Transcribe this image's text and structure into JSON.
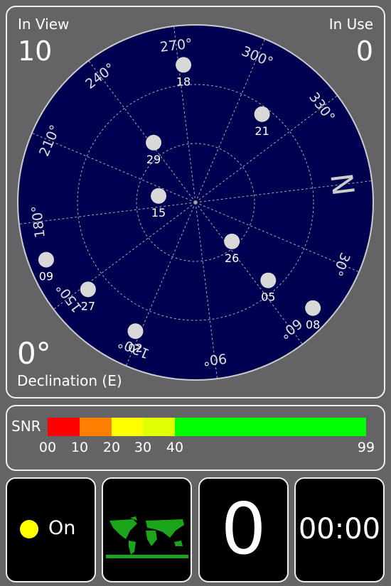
{
  "in_view": {
    "label": "In View",
    "value": "10"
  },
  "in_use": {
    "label": "In Use",
    "value": "0"
  },
  "declination": {
    "value": "0°",
    "label": "Declination (E)"
  },
  "compass": {
    "north_label": "N",
    "bearing_labels": [
      "30°",
      "60°",
      "90°",
      "120°",
      "150°",
      "180°",
      "210°",
      "240°",
      "270°",
      "300°",
      "330°"
    ]
  },
  "satellites": [
    {
      "prn": "18",
      "azimuth": 272,
      "elevation": 20
    },
    {
      "prn": "21",
      "azimuth": 314,
      "elevation": 34
    },
    {
      "prn": "29",
      "azimuth": 242,
      "elevation": 53
    },
    {
      "prn": "15",
      "azimuth": 197,
      "elevation": 71
    },
    {
      "prn": "26",
      "azimuth": 54,
      "elevation": 63
    },
    {
      "prn": "05",
      "azimuth": 54,
      "elevation": 36
    },
    {
      "prn": "08",
      "azimuth": 49,
      "elevation": 10
    },
    {
      "prn": "09",
      "azimuth": 166,
      "elevation": 9
    },
    {
      "prn": "27",
      "azimuth": 148,
      "elevation": 20
    },
    {
      "prn": "02",
      "azimuth": 122,
      "elevation": 18
    }
  ],
  "snr": {
    "label": "SNR",
    "ticks": [
      "00",
      "10",
      "20",
      "30",
      "40",
      "99"
    ],
    "segments": [
      {
        "color": "#ff0000"
      },
      {
        "color": "#ff8000"
      },
      {
        "color": "#ffff00"
      },
      {
        "color": "#e0ff00"
      },
      {
        "color": "#00ff00"
      }
    ]
  },
  "tiles": {
    "gps_status": "On",
    "gps_indicator_color": "#ffff00",
    "fix_count": "0",
    "time": "00:00"
  },
  "colors": {
    "sky": "#000050",
    "background": "#646466"
  }
}
